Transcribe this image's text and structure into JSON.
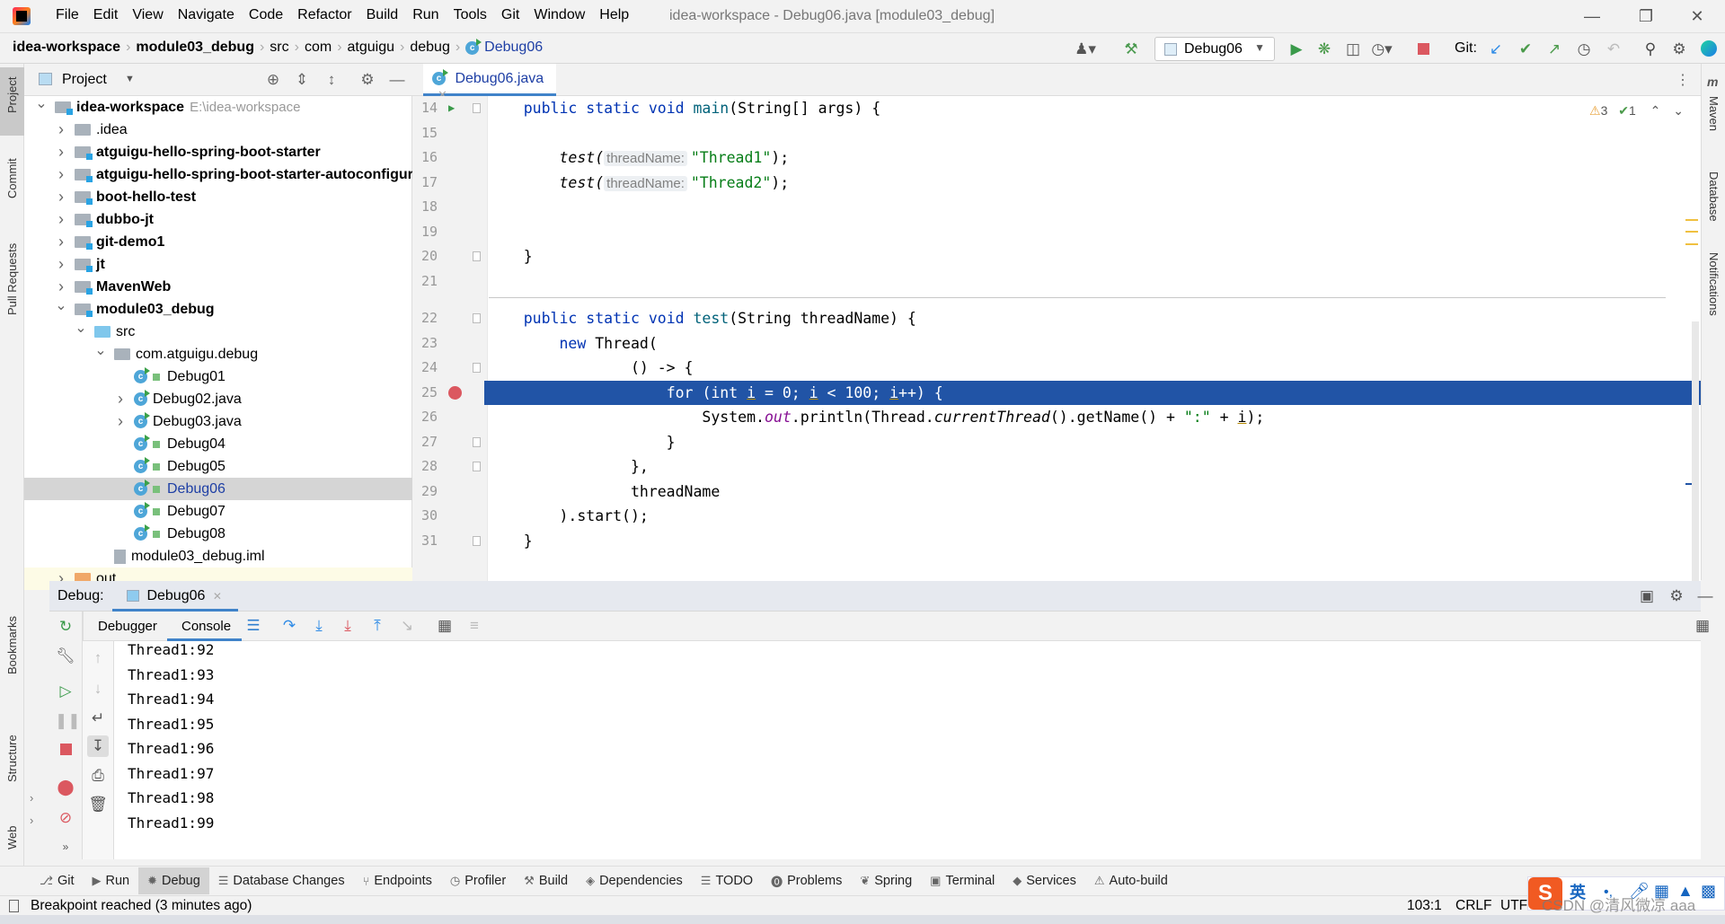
{
  "window": {
    "title": "idea-workspace - Debug06.java [module03_debug]",
    "menu": [
      "File",
      "Edit",
      "View",
      "Navigate",
      "Code",
      "Refactor",
      "Build",
      "Run",
      "Tools",
      "Git",
      "Window",
      "Help"
    ]
  },
  "breadcrumb": [
    "idea-workspace",
    "module03_debug",
    "src",
    "com",
    "atguigu",
    "debug",
    "Debug06"
  ],
  "toolbar": {
    "run_config": "Debug06",
    "git_label": "Git:"
  },
  "left_stripe": [
    "Project",
    "Commit",
    "Pull Requests",
    "Bookmarks",
    "Structure",
    "Web"
  ],
  "right_stripe": [
    "Maven",
    "Database",
    "Notifications"
  ],
  "project": {
    "title": "Project",
    "tree": [
      {
        "label": "idea-workspace",
        "hint": "E:\\idea-workspace",
        "bold": true,
        "expanded": true
      },
      {
        "label": ".idea",
        "bold": false
      },
      {
        "label": "atguigu-hello-spring-boot-starter",
        "bold": true
      },
      {
        "label": "atguigu-hello-spring-boot-starter-autoconfigure",
        "bold": true
      },
      {
        "label": "boot-hello-test",
        "bold": true
      },
      {
        "label": "dubbo-jt",
        "bold": true
      },
      {
        "label": "git-demo1",
        "bold": true
      },
      {
        "label": "jt",
        "bold": true
      },
      {
        "label": "MavenWeb",
        "bold": true
      },
      {
        "label": "module03_debug",
        "bold": true,
        "expanded": true
      },
      {
        "label": "src",
        "expanded": true
      },
      {
        "label": "com.atguigu.debug",
        "expanded": true
      },
      {
        "label": "Debug01"
      },
      {
        "label": "Debug02.java"
      },
      {
        "label": "Debug03.java"
      },
      {
        "label": "Debug04"
      },
      {
        "label": "Debug05"
      },
      {
        "label": "Debug06",
        "selected": true
      },
      {
        "label": "Debug07"
      },
      {
        "label": "Debug08"
      },
      {
        "label": "module03_debug.iml"
      },
      {
        "label": "out"
      }
    ]
  },
  "editor": {
    "tab": "Debug06.java",
    "inspections": {
      "warnings": "3",
      "ok": "1"
    },
    "lines": [
      {
        "n": "14",
        "tokens": [
          [
            "    "
          ],
          [
            "public static void ",
            "kw"
          ],
          [
            "main",
            "mth"
          ],
          [
            "(String[] args) {"
          ]
        ]
      },
      {
        "n": "15",
        "tokens": []
      },
      {
        "n": "16",
        "tokens": [
          [
            "        "
          ],
          [
            "test(",
            "it"
          ],
          [
            "threadName:",
            "hint"
          ],
          [
            "\"Thread1\"",
            "str"
          ],
          [
            ");"
          ]
        ]
      },
      {
        "n": "17",
        "tokens": [
          [
            "        "
          ],
          [
            "test(",
            "it"
          ],
          [
            "threadName:",
            "hint"
          ],
          [
            "\"Thread2\"",
            "str"
          ],
          [
            ");"
          ]
        ]
      },
      {
        "n": "18",
        "tokens": []
      },
      {
        "n": "19",
        "tokens": []
      },
      {
        "n": "20",
        "tokens": [
          [
            "    }"
          ]
        ]
      },
      {
        "n": "21",
        "tokens": []
      },
      {
        "n": "22",
        "tokens": [
          [
            "    "
          ],
          [
            "public static void ",
            "kw"
          ],
          [
            "test",
            "mth"
          ],
          [
            "(String threadName) {"
          ]
        ]
      },
      {
        "n": "23",
        "tokens": [
          [
            "        "
          ],
          [
            "new ",
            "kw"
          ],
          [
            "Thread("
          ]
        ]
      },
      {
        "n": "24",
        "tokens": [
          [
            "                () -> {"
          ]
        ]
      },
      {
        "n": "25",
        "tokens": [
          [
            "                    "
          ],
          [
            "for ",
            "kw"
          ],
          [
            "("
          ],
          [
            "int ",
            "kw"
          ],
          [
            "i",
            "ul"
          ],
          [
            " = 0; "
          ],
          [
            "i",
            "ul"
          ],
          [
            " < 100; "
          ],
          [
            "i",
            "ul"
          ],
          [
            "++) {"
          ]
        ],
        "highlight": true
      },
      {
        "n": "26",
        "tokens": [
          [
            "                        System."
          ],
          [
            "out",
            "fld"
          ],
          [
            ".println(Thread."
          ],
          [
            "currentThread",
            "it"
          ],
          [
            "().getName() + "
          ],
          [
            "\":\"",
            "str"
          ],
          [
            " + "
          ],
          [
            "i",
            "ul"
          ],
          [
            ");"
          ]
        ]
      },
      {
        "n": "27",
        "tokens": [
          [
            "                    }"
          ]
        ]
      },
      {
        "n": "28",
        "tokens": [
          [
            "                },"
          ]
        ]
      },
      {
        "n": "29",
        "tokens": [
          [
            "                threadName"
          ]
        ]
      },
      {
        "n": "30",
        "tokens": [
          [
            "        ).start();"
          ]
        ]
      },
      {
        "n": "31",
        "tokens": [
          [
            "    }"
          ]
        ]
      }
    ]
  },
  "debug": {
    "label": "Debug:",
    "tab": "Debug06",
    "subtabs": [
      "Debugger",
      "Console"
    ],
    "active_subtab": "Console",
    "console": [
      "Thread1:92",
      "Thread1:93",
      "Thread1:94",
      "Thread1:95",
      "Thread1:96",
      "Thread1:97",
      "Thread1:98",
      "Thread1:99"
    ]
  },
  "bottom_tools": [
    {
      "label": "Git",
      "icon": "git"
    },
    {
      "label": "Run",
      "icon": "run"
    },
    {
      "label": "Debug",
      "icon": "bug",
      "active": true
    },
    {
      "label": "Database Changes",
      "icon": "database"
    },
    {
      "label": "Endpoints",
      "icon": "endpoints"
    },
    {
      "label": "Profiler",
      "icon": "profiler"
    },
    {
      "label": "Build",
      "icon": "hammer"
    },
    {
      "label": "Dependencies",
      "icon": "layers"
    },
    {
      "label": "TODO",
      "icon": "list"
    },
    {
      "label": "Problems",
      "icon": "alert"
    },
    {
      "label": "Spring",
      "icon": "leaf"
    },
    {
      "label": "Terminal",
      "icon": "terminal"
    },
    {
      "label": "Services",
      "icon": "services"
    },
    {
      "label": "Auto-build",
      "icon": "warning"
    }
  ],
  "status": {
    "message": "Breakpoint reached (3 minutes ago)",
    "position": "103:1",
    "line_sep": "CRLF",
    "encoding": "UTF-8"
  },
  "overlay": {
    "ime_lang": "英",
    "watermark": "CSDN @清风微凉 aaa"
  },
  "colors": {
    "accent": "#2154a6",
    "keyword": "#0033b3",
    "string": "#067d17",
    "field": "#871094"
  }
}
